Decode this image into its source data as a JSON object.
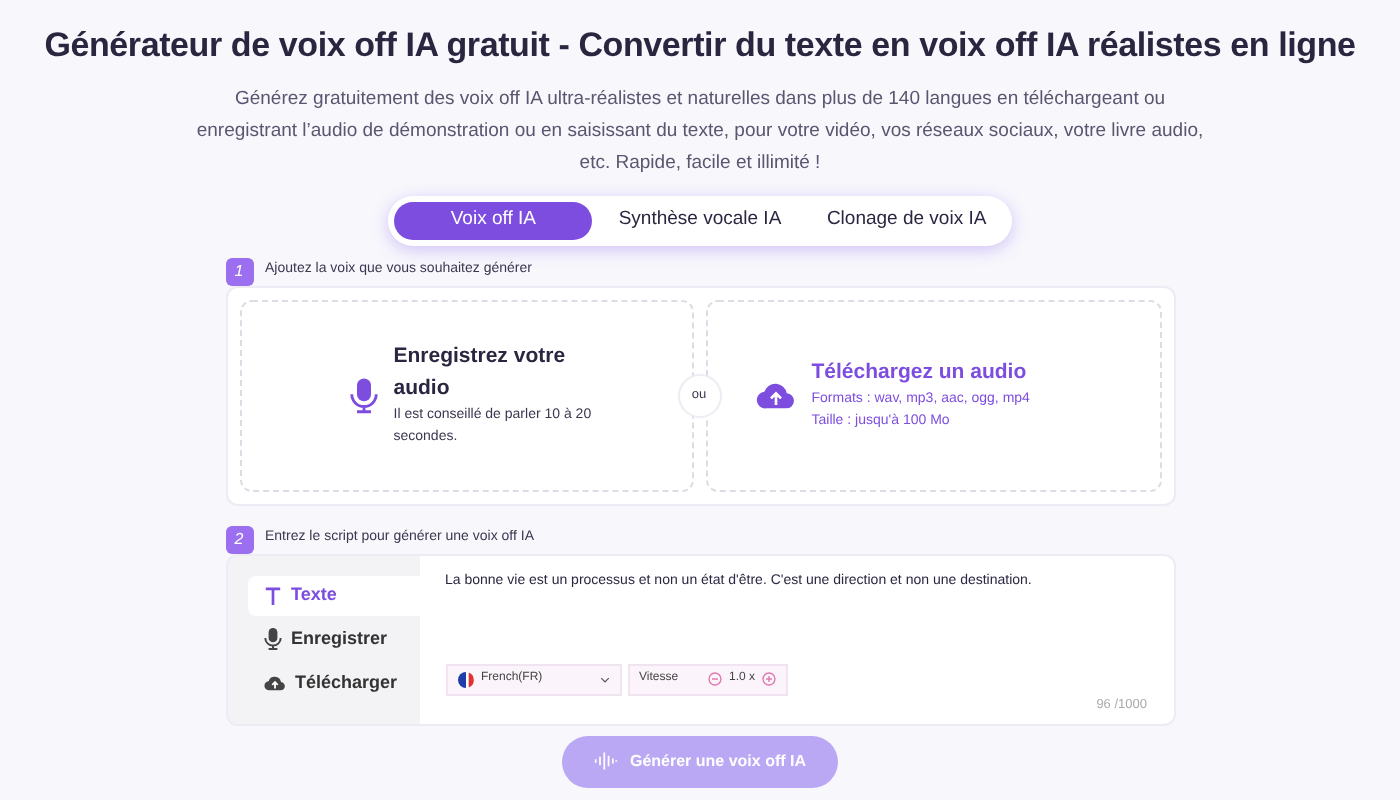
{
  "title": "Générateur de voix off IA gratuit - Convertir du texte en voix off IA réalistes en ligne",
  "description": "Générez gratuitement des voix off IA ultra-réalistes et naturelles dans plus de 140 langues en téléchargeant ou enregistrant l’audio de démonstration ou en saisissant du texte, pour votre vidéo, vos réseaux sociaux, votre livre audio, etc. Rapide, facile et illimité !",
  "tabs": [
    {
      "label": "Voix off IA",
      "selected": true
    },
    {
      "label": "Synthèse vocale IA",
      "selected": false
    },
    {
      "label": "Clonage de voix IA",
      "selected": false
    }
  ],
  "step1": {
    "number": "1",
    "label": "Ajoutez la voix que vous souhaitez générer",
    "options": [
      {
        "kind": "record",
        "title": "Enregistrez votre audio",
        "lines": [
          "Il est conseillé de parler 10 à 20 secondes."
        ]
      },
      {
        "kind": "upload",
        "title": "Téléchargez un audio",
        "lines": [
          "Formats : wav, mp3, aac, ogg, mp4",
          "Taille : jusqu'à 100 Mo"
        ]
      }
    ],
    "separator": "ou"
  },
  "step2": {
    "number": "2",
    "label": "Entrez le script pour générer une voix off IA",
    "modes": [
      {
        "kind": "text",
        "label": "Texte",
        "selected": true
      },
      {
        "kind": "record",
        "label": "Enregistrer",
        "selected": false
      },
      {
        "kind": "upload",
        "label": "Télécharger",
        "selected": false
      }
    ],
    "script": "La bonne vie est un processus et non un état d'être. C'est une direction et non une destination.",
    "language": "French(FR)",
    "speed_label": "Vitesse",
    "speed": "1.0 x",
    "counter": "96 /1000"
  },
  "generate_button": {
    "label": "Générer une voix off IA",
    "disabled": true
  }
}
